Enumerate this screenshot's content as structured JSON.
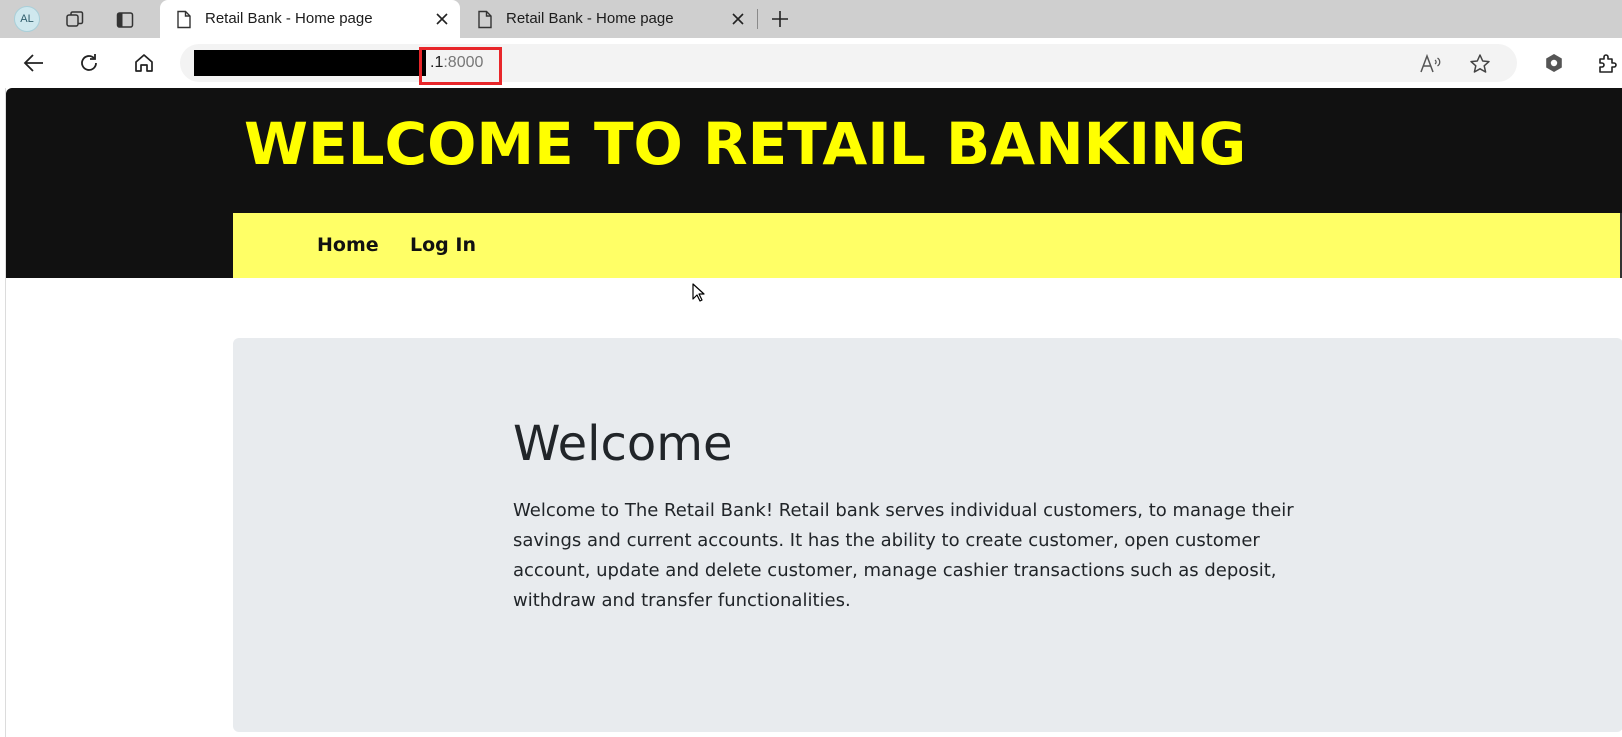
{
  "browser": {
    "profile_initials": "AL",
    "tabs": [
      {
        "label": "Retail Bank - Home page",
        "active": true
      },
      {
        "label": "Retail Bank - Home page",
        "active": false
      }
    ],
    "address": {
      "visible_host_suffix": ".1",
      "port": ":8000"
    }
  },
  "site": {
    "title": "WELCOME TO RETAIL BANKING",
    "title_color": "#ffff00",
    "header_bg": "#111111",
    "nav_bg": "#ffff66",
    "nav": [
      {
        "label": "Home"
      },
      {
        "label": "Log In"
      }
    ]
  },
  "jumbotron": {
    "heading": "Welcome",
    "body": "Welcome to The Retail Bank! Retail bank serves individual customers, to manage their savings and current accounts. It has the ability to create customer, open customer account, update and delete customer, manage cashier transactions such as deposit, withdraw and transfer functionalities.",
    "bg": "#e8ebee"
  },
  "icons": {
    "tab_strip": [
      "workspaces-icon",
      "vertical-tabs-icon"
    ],
    "toolbar": [
      "back-arrow-icon",
      "refresh-icon",
      "home-icon",
      "read-aloud-icon",
      "favorite-star-icon",
      "copilot-icon",
      "extensions-icon"
    ]
  }
}
